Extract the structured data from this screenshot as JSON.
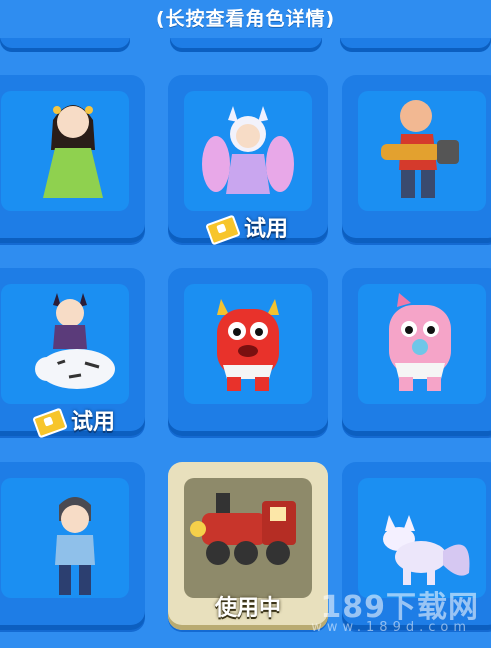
{
  "header": {
    "hint": "(长按查看角色详情)"
  },
  "characters": [
    {
      "name": "ancient-lady",
      "badge": ""
    },
    {
      "name": "nine-tail-fox-girl",
      "badge": "试用"
    },
    {
      "name": "chainsaw-man",
      "badge": ""
    },
    {
      "name": "cat-girl-on-white-tiger",
      "badge": "试用"
    },
    {
      "name": "red-monster",
      "badge": ""
    },
    {
      "name": "pink-pacifier-monster",
      "badge": ""
    },
    {
      "name": "boy-in-blue",
      "badge": ""
    },
    {
      "name": "red-train",
      "badge": "",
      "status": "使用中"
    },
    {
      "name": "white-fox",
      "badge": ""
    }
  ],
  "watermark": {
    "brand": "189下载网",
    "url": "www.189d.com"
  },
  "colors": {
    "background": "#2f8df0",
    "card": "#1e7de6",
    "selected": "#e8e0bd",
    "ticket": "#f7c52b"
  }
}
